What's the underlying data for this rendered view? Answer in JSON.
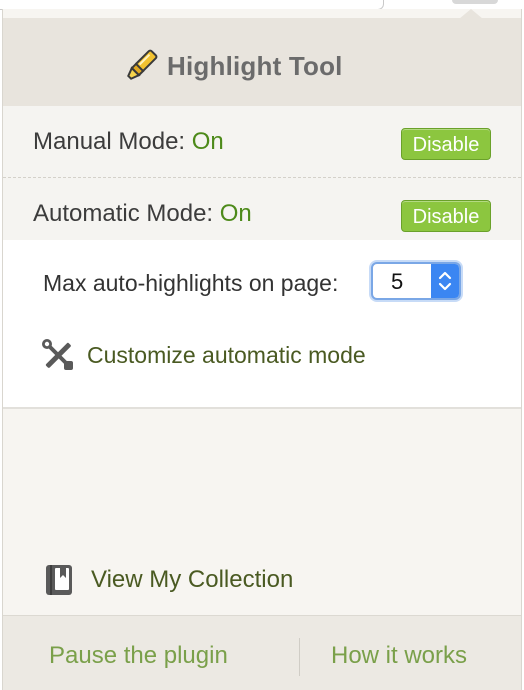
{
  "header": {
    "title": "Highlight Tool",
    "icon": "highlighter-pen-icon"
  },
  "modes": [
    {
      "label": "Manual Mode: ",
      "state": "On",
      "button_label": "Disable"
    },
    {
      "label": "Automatic Mode: ",
      "state": "On",
      "button_label": "Disable"
    }
  ],
  "auto_settings": {
    "max_label": "Max auto-highlights on page:",
    "max_value": "5",
    "customize_label": "Customize automatic mode",
    "customize_icon": "tools-icon"
  },
  "collection": {
    "label": "View My Collection",
    "icon": "book-icon"
  },
  "footer": {
    "pause_label": "Pause the plugin",
    "how_label": "How it works"
  },
  "colors": {
    "accent_green": "#8cc63f",
    "state_green": "#4d8a1a",
    "link_green": "#7aa04a",
    "select_blue": "#3b86f2"
  }
}
